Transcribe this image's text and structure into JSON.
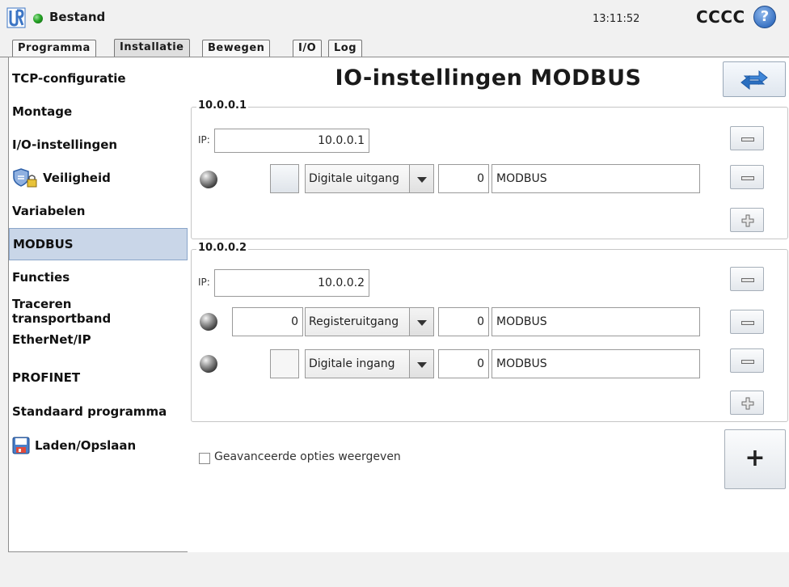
{
  "header": {
    "status_text": "Bestand",
    "time": "13:11:52",
    "robot_name": "CCCC",
    "help_label": "?"
  },
  "tabs": [
    {
      "label": "Programma",
      "active": false
    },
    {
      "label": "Installatie",
      "active": true
    },
    {
      "label": "Bewegen",
      "active": false
    },
    {
      "label": "I/O",
      "active": false
    },
    {
      "label": "Log",
      "active": false
    }
  ],
  "sidebar": {
    "items": [
      {
        "label": "TCP-configuratie"
      },
      {
        "label": "Montage"
      },
      {
        "label": "I/O-instellingen"
      },
      {
        "label": "Veiligheid",
        "icon": "shield-lock-icon"
      },
      {
        "label": "Variabelen"
      },
      {
        "label": "MODBUS",
        "selected": true
      },
      {
        "label": "Functies"
      },
      {
        "label": "Traceren transportband"
      },
      {
        "label": "EtherNet/IP"
      },
      {
        "label": "PROFINET"
      },
      {
        "label": "Standaard programma"
      },
      {
        "label": "Laden/Opslaan",
        "icon": "floppy-disk-icon"
      }
    ]
  },
  "main": {
    "title": "IO-instellingen MODBUS",
    "ip_prefix": "IP:",
    "units": [
      {
        "group_label": "10.0.0.1",
        "ip": "10.0.0.1",
        "signals": [
          {
            "value": "",
            "type": "Digitale uitgang",
            "address": "0",
            "name": "MODBUS"
          }
        ]
      },
      {
        "group_label": "10.0.0.2",
        "ip": "10.0.0.2",
        "signals": [
          {
            "value": "0",
            "type": "Registeruitgang",
            "address": "0",
            "name": "MODBUS"
          },
          {
            "value": "",
            "type": "Digitale ingang",
            "address": "0",
            "name": "MODBUS"
          }
        ]
      }
    ],
    "advanced_options_label": "Geavanceerde opties weergeven",
    "advanced_options_checked": false,
    "add_unit_label": "+"
  },
  "colors": {
    "selected_bg": "#c9d6e8",
    "status_green": "#27a527",
    "help_blue": "#3b74c4"
  }
}
